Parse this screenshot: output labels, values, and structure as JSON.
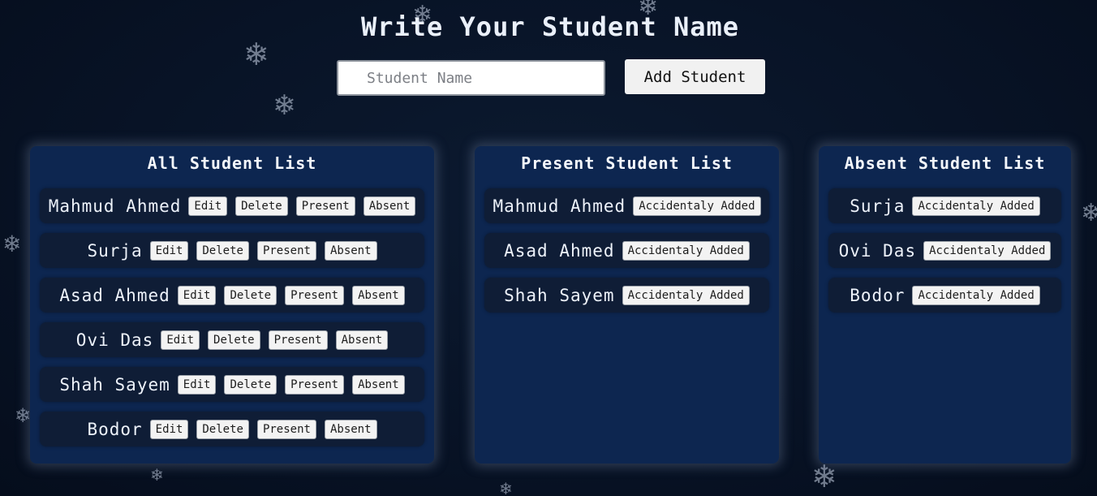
{
  "header": {
    "title": "Write Your Student Name"
  },
  "form": {
    "input_placeholder": "Student Name",
    "input_value": "",
    "add_button_label": "Add Student"
  },
  "all_list": {
    "title": "All Student List",
    "students": [
      "Mahmud Ahmed",
      "Surja",
      "Asad Ahmed",
      "Ovi Das",
      "Shah Sayem",
      "Bodor"
    ],
    "actions": {
      "edit": "Edit",
      "delete": "Delete",
      "present": "Present",
      "absent": "Absent"
    }
  },
  "present_list": {
    "title": "Present Student List",
    "students": [
      "Mahmud Ahmed",
      "Asad Ahmed",
      "Shah Sayem"
    ],
    "action_label": "Accidentaly Added"
  },
  "absent_list": {
    "title": "Absent Student List",
    "students": [
      "Surja",
      "Ovi Das",
      "Bodor"
    ],
    "action_label": "Accidentaly Added"
  },
  "theme": {
    "background": "#081326",
    "panel": "#0d2650",
    "row": "#0f1d36",
    "text": "#eaf0fa"
  },
  "decor": {
    "snowflake_icon": "snowflake-icon"
  }
}
